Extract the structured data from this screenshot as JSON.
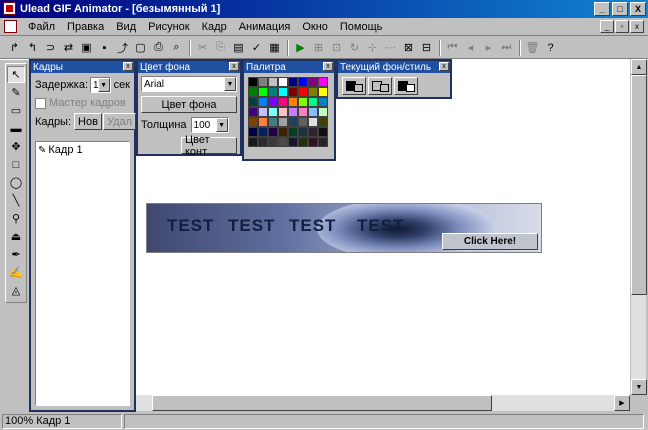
{
  "title": "Ulead GIF Animator - [безымянный 1]",
  "titlebar_buttons": [
    "_",
    "□",
    "X"
  ],
  "menu": [
    "Файл",
    "Правка",
    "Вид",
    "Рисунок",
    "Кадр",
    "Анимация",
    "Окно",
    "Помощь"
  ],
  "mdi_buttons": [
    "_",
    "▫",
    "x"
  ],
  "toolbar_glyphs": [
    "↱",
    "↰",
    "⊃",
    "⇄",
    "▣",
    "▪",
    "⤴",
    "▢",
    "⎙",
    "⌕",
    "✂",
    "⎘",
    "▤",
    "✓",
    "▦",
    "▶",
    "⊞",
    "⊡",
    "↻",
    "⊹",
    "⋯",
    "⊠",
    "⊟",
    "⏮",
    "◂",
    "▸",
    "⏭",
    "🗑",
    "?"
  ],
  "left_tools": [
    "↖",
    "✎",
    "▭",
    "▬",
    "✥",
    "□",
    "◯",
    "╲",
    "⚲",
    "⏏",
    "✒",
    "✍",
    "◬"
  ],
  "frames_panel": {
    "title": "Кадры",
    "delay_label": "Задержка:",
    "delay_value": "1",
    "delay_unit": "сек",
    "master_label": "Мастер кадров",
    "frames_label": "Кадры:",
    "new_label": "Нов",
    "delete_label": "Удал",
    "frame_item": "Кадр 1"
  },
  "bgcolor_panel": {
    "title": "Цвет фона",
    "font_value": "Arial",
    "bg_button": "Цвет фона",
    "thickness_label": "Толщина",
    "thickness_value": "100",
    "outline_button": "Цвет конт"
  },
  "palette_panel": {
    "title": "Палитра",
    "colors": [
      "#000000",
      "#808080",
      "#c0c0c0",
      "#ffffff",
      "#000080",
      "#0000ff",
      "#800080",
      "#ff00ff",
      "#008000",
      "#00ff00",
      "#008080",
      "#00ffff",
      "#800000",
      "#ff0000",
      "#808000",
      "#ffff00",
      "#004040",
      "#0080ff",
      "#8000ff",
      "#ff0080",
      "#ff8000",
      "#80ff00",
      "#00ff80",
      "#0080c0",
      "#400080",
      "#c0c0ff",
      "#80ffff",
      "#ffc0c0",
      "#c080ff",
      "#ff80c0",
      "#80c0ff",
      "#c0ffc0",
      "#804000",
      "#ff8040",
      "#408080",
      "#a0a0a0",
      "#204060",
      "#606060",
      "#e0e0e0",
      "#404000",
      "#000040",
      "#002060",
      "#200040",
      "#402000",
      "#004020",
      "#203040",
      "#302030",
      "#101010",
      "#1a1a1a",
      "#2a2a2a",
      "#3a3a3a",
      "#4a4a4a",
      "#151530",
      "#203010",
      "#301520",
      "#252525"
    ]
  },
  "texture_panel": {
    "title": "Текущий фон/стиль"
  },
  "banner": {
    "words": [
      "TEST",
      "TEST",
      "TEST",
      "TEST"
    ],
    "button": "Click Here!"
  },
  "statusbar": {
    "zoom": "100% Кадр 1"
  }
}
